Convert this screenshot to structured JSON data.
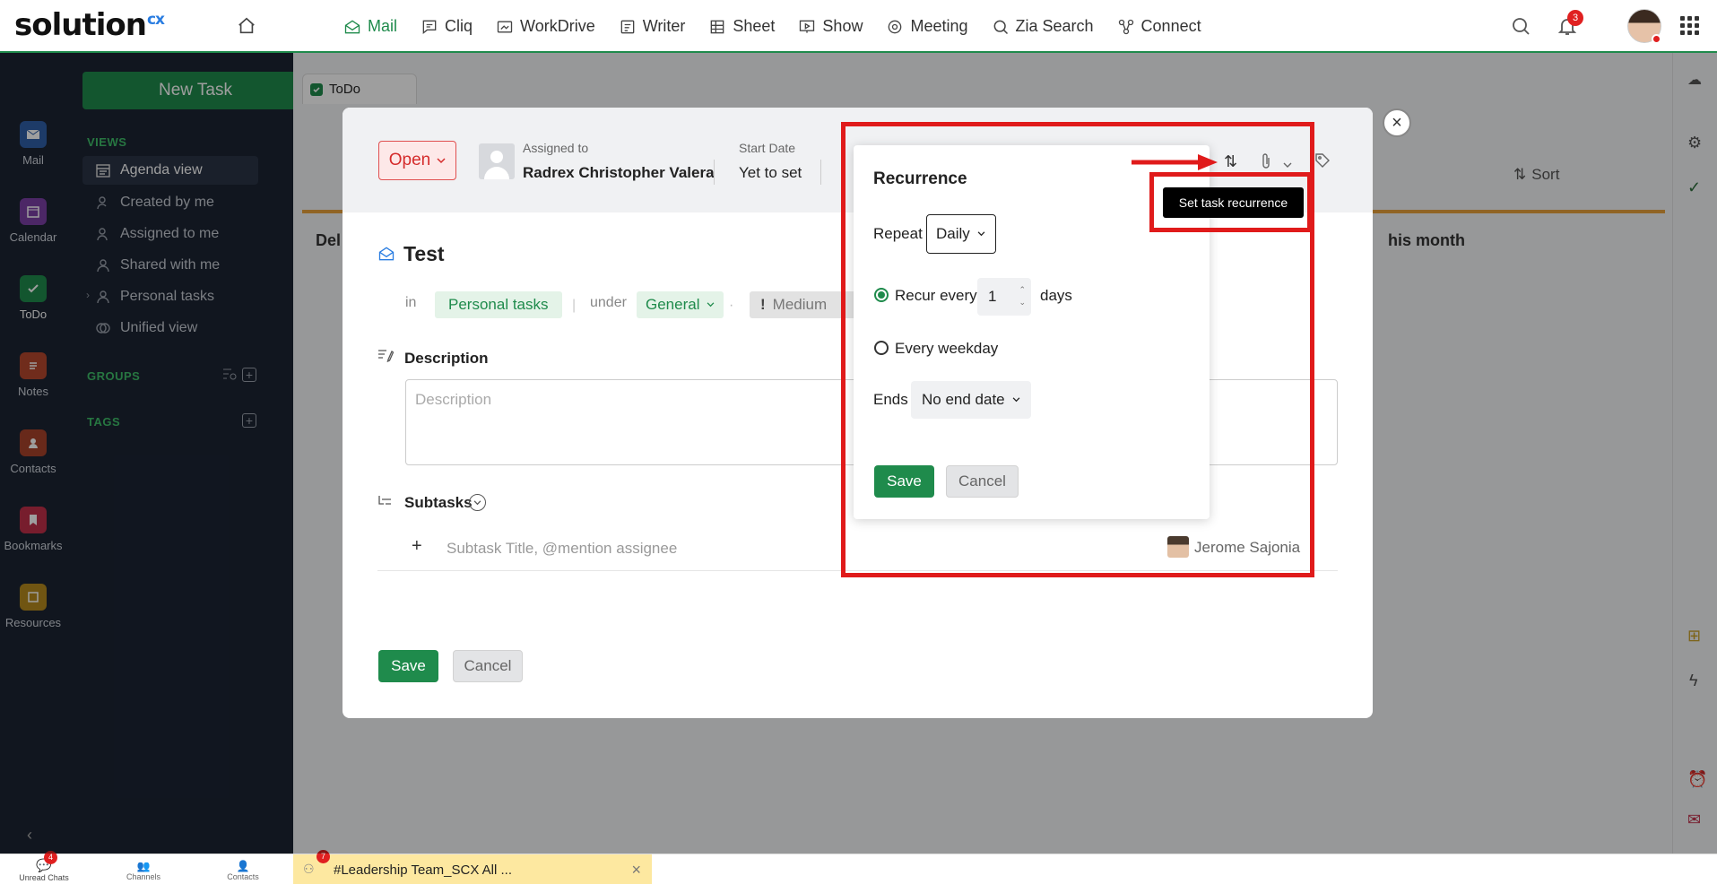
{
  "app": {
    "logo": "solution",
    "logo_suffix": "cx"
  },
  "nav": [
    {
      "label": "Mail",
      "icon": "mail-icon"
    },
    {
      "label": "Cliq",
      "icon": "chat-icon"
    },
    {
      "label": "WorkDrive",
      "icon": "drive-icon"
    },
    {
      "label": "Writer",
      "icon": "writer-icon"
    },
    {
      "label": "Sheet",
      "icon": "sheet-icon"
    },
    {
      "label": "Show",
      "icon": "show-icon"
    },
    {
      "label": "Meeting",
      "icon": "meeting-icon"
    },
    {
      "label": "Zia Search",
      "icon": "search-icon"
    },
    {
      "label": "Connect",
      "icon": "connect-icon"
    }
  ],
  "notifications_count": "3",
  "rail": [
    {
      "label": "Mail",
      "color": "#2f5fa8"
    },
    {
      "label": "Calendar",
      "color": "#7b3fa5"
    },
    {
      "label": "ToDo",
      "color": "#1f8b4c"
    },
    {
      "label": "Notes",
      "color": "#b5482e"
    },
    {
      "label": "Contacts",
      "color": "#a8432a"
    },
    {
      "label": "Bookmarks",
      "color": "#c0304a"
    },
    {
      "label": "Resources",
      "color": "#b58a1e"
    }
  ],
  "sidebar": {
    "new_task": "New Task",
    "views_title": "VIEWS",
    "views": [
      "Agenda view",
      "Created by me",
      "Assigned to me",
      "Shared with me",
      "Personal tasks",
      "Unified view"
    ],
    "groups_title": "GROUPS",
    "tags_title": "TAGS"
  },
  "tab": {
    "label": "ToDo"
  },
  "background": {
    "section_left": "Del",
    "section_right": "his month",
    "sort_label": "Sort"
  },
  "task": {
    "status": "Open",
    "assigned_label": "Assigned to",
    "assignee": "Radrex Christopher Valera",
    "start_label": "Start Date",
    "start_value": "Yet to set",
    "title": "Test",
    "in_label": "in",
    "category": "Personal tasks",
    "under_label": "under",
    "group": "General",
    "priority": "Medium",
    "description_label": "Description",
    "description_placeholder": "Description",
    "subtasks_label": "Subtasks",
    "subtask_placeholder": "Subtask Title, @mention assignee",
    "subtask_assignee": "Jerome Sajonia",
    "save": "Save",
    "cancel": "Cancel"
  },
  "recurrence": {
    "title": "Recurrence",
    "repeat_label": "Repeat",
    "repeat_value": "Daily",
    "recur_every_label": "Recur every",
    "recur_every_value": "1",
    "recur_unit": "days",
    "every_weekday_label": "Every weekday",
    "ends_label": "Ends",
    "ends_value": "No end date",
    "save": "Save",
    "cancel": "Cancel",
    "selected_option": "recur-every"
  },
  "tooltip": "Set task recurrence",
  "bottom": {
    "unread_chats": "Unread Chats",
    "unread_count": "4",
    "channels": "Channels",
    "contacts": "Contacts",
    "chat_title": "#Leadership Team_SCX All ...",
    "chat_count": "7"
  }
}
